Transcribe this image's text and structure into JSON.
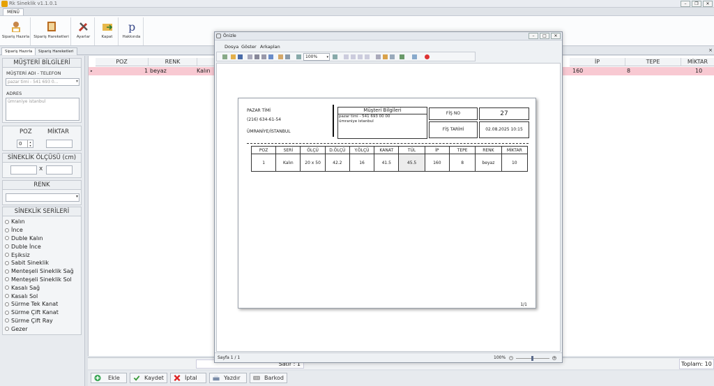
{
  "app": {
    "title": "Rk Sineklik v1.1.0.1",
    "menu_tab": "MENÜ"
  },
  "ribbon": [
    {
      "label": "Sipariş Hazırla",
      "icon": "user-form-icon"
    },
    {
      "label": "Sipariş Hareketleri",
      "icon": "book-icon"
    },
    {
      "label": "Ayarlar",
      "icon": "tools-icon"
    },
    {
      "label": "Kapat",
      "icon": "folder-exit-icon"
    },
    {
      "label": "Hakkında",
      "icon": "p-letter-icon"
    }
  ],
  "doc_tabs": [
    "Sipariş Hazırla",
    "Sipariş Hareketleri"
  ],
  "left": {
    "customer_title": "MÜŞTERİ BİLGİLERİ",
    "name_label": "MÜŞTERİ ADI - TELEFON",
    "name_value": "pazar timi - 541 693 0...",
    "address_label": "ADRES",
    "address_value": "ümraniye istanbul",
    "poz_label": "POZ",
    "miktar_label": "MİKTAR",
    "poz_value": "0",
    "size_title": "SİNEKLİK ÖLÇÜSÜ (cm)",
    "x_label": "x",
    "color_title": "RENK",
    "series_title": "SİNEKLİK SERİLERİ",
    "series": [
      "Kalın",
      "İnce",
      "Duble Kalın",
      "Duble İnce",
      "Eşiksiz",
      "Sabit Sineklik",
      "Menteşeli Sineklik Sağ",
      "Menteşeli Sineklik Sol",
      "Kasalı Sağ",
      "Kasalı Sol",
      "Sürme Tek Kanat",
      "Sürme Çift Kanat",
      "Sürme Çift Ray",
      "Gezer"
    ]
  },
  "grid": {
    "headers": {
      "poz": "POZ",
      "renk": "RENK",
      "ip": "İP",
      "tepe": "TEPE",
      "miktar": "MİKTAR"
    },
    "row": {
      "poz": "1",
      "renk": "beyaz",
      "seri": "Kalın",
      "ip": "160",
      "tepe": "8",
      "miktar": "10"
    }
  },
  "footer": {
    "sat": "Satır : 1",
    "toplam": "Toplam: 10"
  },
  "buttons": {
    "ekle": "Ekle",
    "kaydet": "Kaydet",
    "iptal": "İptal",
    "yazdir": "Yazdır",
    "barkod": "Barkod"
  },
  "preview": {
    "title": "Önizle",
    "menu": [
      "Dosya",
      "Göster",
      "Arkaplan"
    ],
    "zoom": "100%",
    "status_page": "Sayfa 1 / 1",
    "status_zoom": "100%",
    "page": {
      "company_name": "PAZAR TİMİ",
      "company_phone": "(216) 634-61-54",
      "company_city": "ÜMRANİYE/İSTANBUL",
      "customer_title": "Müşteri Bilgileri",
      "customer_line1": "pazar timi - 541 693 00 00",
      "customer_line2": "ümraniye istanbul",
      "fis_no_label": "FİŞ NO",
      "fis_no": "27",
      "fis_tarihi_label": "FİŞ TARİHİ",
      "fis_tarihi": "02.08.2025  10:15",
      "table_headers": [
        "POZ",
        "SERİ",
        "ÖLÇÜ",
        "D.ÖLÇÜ",
        "Y.ÖLÇÜ",
        "KANAT",
        "TÜL",
        "İP",
        "TEPE",
        "RENK",
        "MİKTAR"
      ],
      "table_row": [
        "1",
        "Kalın",
        "20 x 50",
        "42.2",
        "16",
        "41.5",
        "45.5",
        "160",
        "8",
        "beyaz",
        "10"
      ],
      "page_num": "1/1"
    }
  }
}
